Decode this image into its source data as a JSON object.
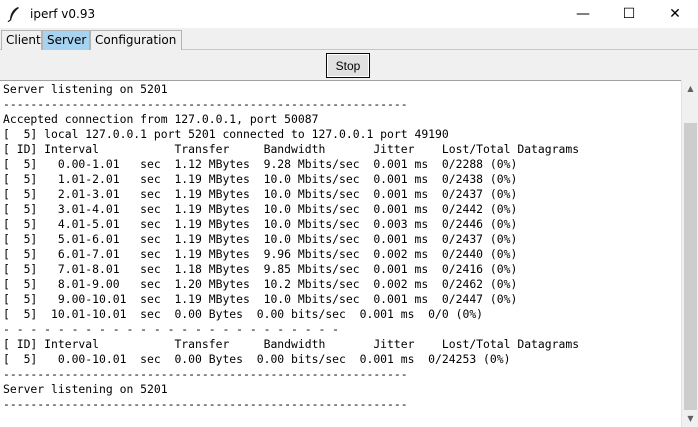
{
  "window": {
    "title": "iperf v0.93",
    "minimize_glyph": "—",
    "maximize_glyph": "☐",
    "close_glyph": "✕",
    "icon": "feather-icon"
  },
  "tabs": [
    {
      "label": "Client",
      "selected": false
    },
    {
      "label": "Server",
      "selected": true
    },
    {
      "label": "Configuration",
      "selected": false
    }
  ],
  "toolbar": {
    "stop_label": "Stop"
  },
  "scrollbar": {
    "up_glyph": "▲",
    "down_glyph": "▼",
    "thumb_color": "#cdcdcd"
  },
  "colors": {
    "selected_tab": "#a6d3f0",
    "background": "#f0f0f0"
  },
  "output": {
    "lines": [
      "Server listening on 5201",
      "-----------------------------------------------------------",
      "Accepted connection from 127.0.0.1, port 50087",
      "[  5] local 127.0.0.1 port 5201 connected to 127.0.0.1 port 49190",
      "[ ID] Interval           Transfer     Bandwidth       Jitter    Lost/Total Datagrams",
      "[  5]   0.00-1.01   sec  1.12 MBytes  9.28 Mbits/sec  0.001 ms  0/2288 (0%)",
      "[  5]   1.01-2.01   sec  1.19 MBytes  10.0 Mbits/sec  0.001 ms  0/2438 (0%)",
      "[  5]   2.01-3.01   sec  1.19 MBytes  10.0 Mbits/sec  0.001 ms  0/2437 (0%)",
      "[  5]   3.01-4.01   sec  1.19 MBytes  10.0 Mbits/sec  0.001 ms  0/2442 (0%)",
      "[  5]   4.01-5.01   sec  1.19 MBytes  10.0 Mbits/sec  0.003 ms  0/2446 (0%)",
      "[  5]   5.01-6.01   sec  1.19 MBytes  10.0 Mbits/sec  0.001 ms  0/2437 (0%)",
      "[  5]   6.01-7.01   sec  1.19 MBytes  9.96 Mbits/sec  0.002 ms  0/2440 (0%)",
      "[  5]   7.01-8.01   sec  1.18 MBytes  9.85 Mbits/sec  0.001 ms  0/2416 (0%)",
      "[  5]   8.01-9.00   sec  1.20 MBytes  10.2 Mbits/sec  0.002 ms  0/2462 (0%)",
      "[  5]   9.00-10.01  sec  1.19 MBytes  10.0 Mbits/sec  0.001 ms  0/2447 (0%)",
      "[  5]  10.01-10.01  sec  0.00 Bytes  0.00 bits/sec  0.001 ms  0/0 (0%)",
      "- - - - - - - - - - - - - - - - - - - - - - - - -",
      "[ ID] Interval           Transfer     Bandwidth       Jitter    Lost/Total Datagrams",
      "[  5]   0.00-10.01  sec  0.00 Bytes  0.00 bits/sec  0.001 ms  0/24253 (0%)",
      "-----------------------------------------------------------",
      "Server listening on 5201",
      "-----------------------------------------------------------"
    ]
  }
}
